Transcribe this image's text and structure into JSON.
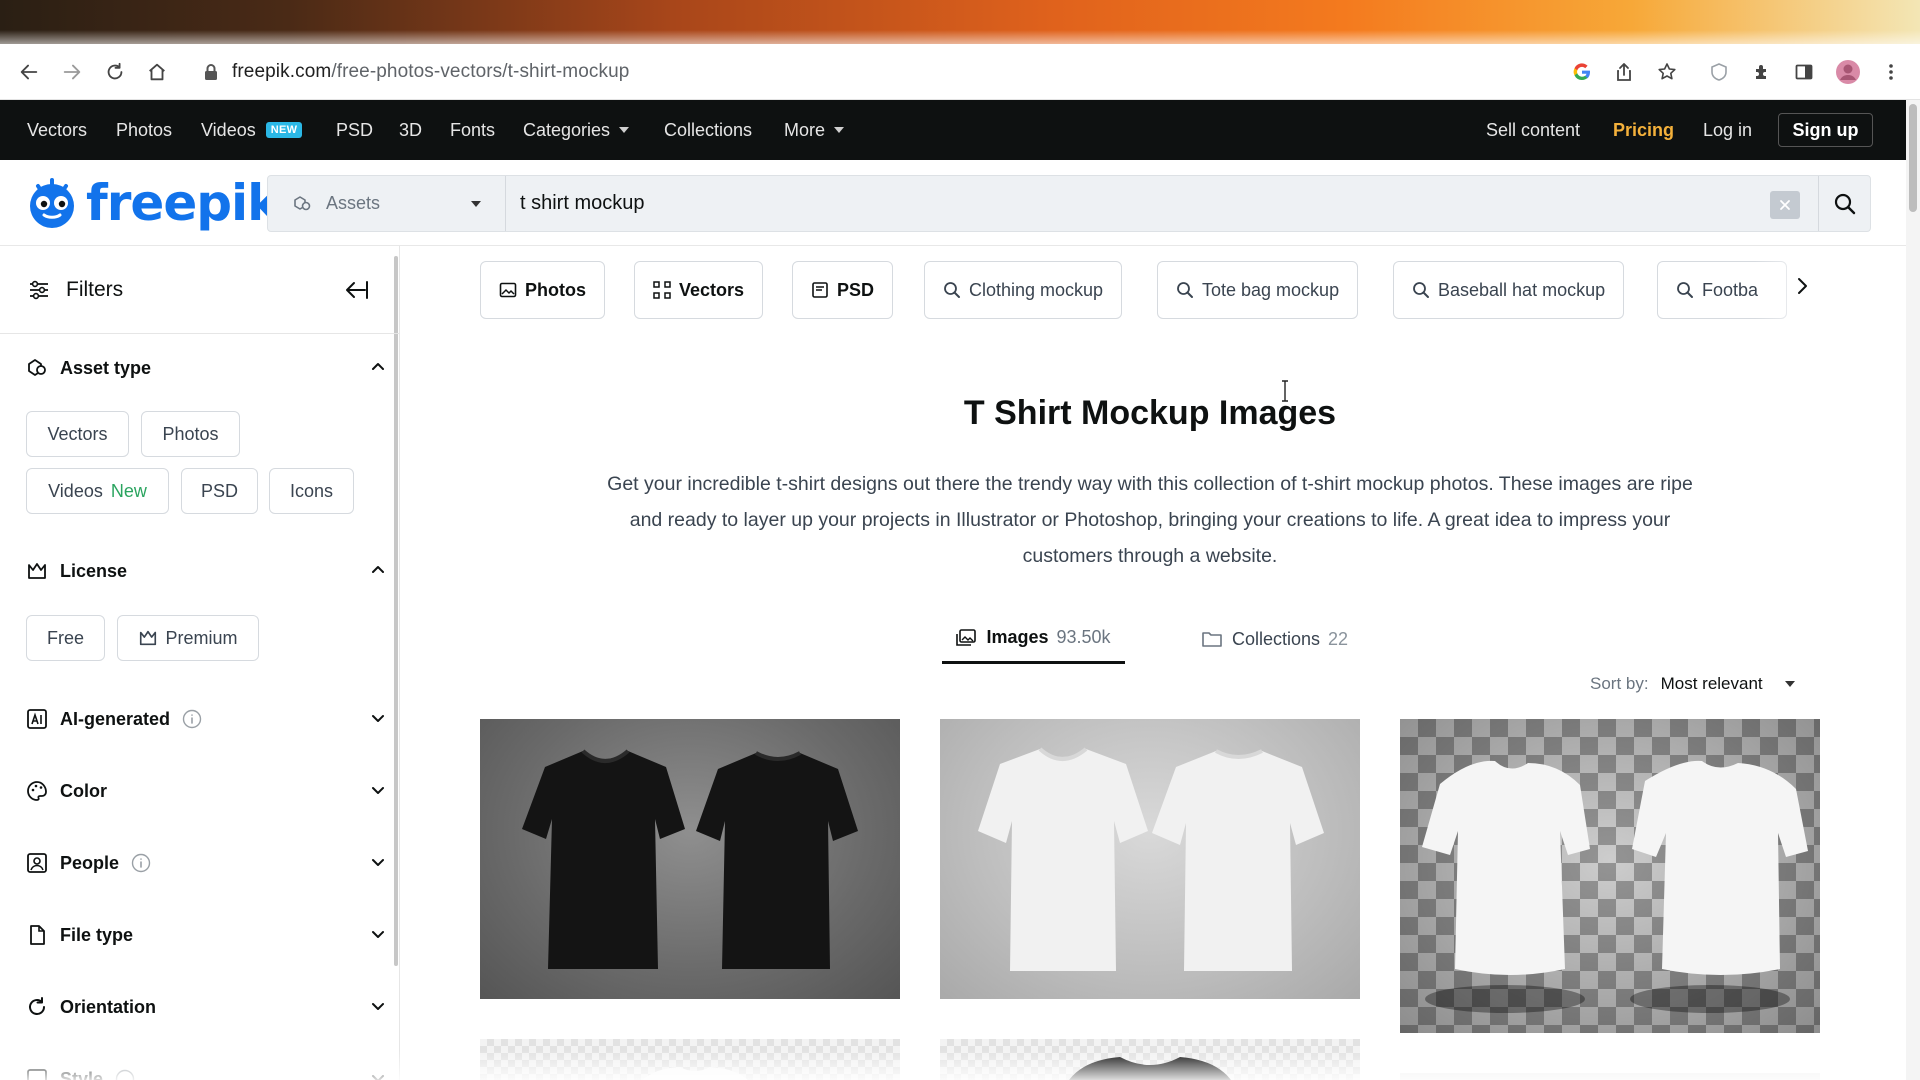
{
  "browser": {
    "url_host": "freepik.com",
    "url_path": "/free-photos-vectors/t-shirt-mockup"
  },
  "site_nav": {
    "items": [
      "Vectors",
      "Photos",
      "Videos",
      "PSD",
      "3D",
      "Fonts",
      "Categories",
      "Collections",
      "More"
    ],
    "new_badge": "NEW",
    "right": {
      "sell": "Sell content",
      "pricing": "Pricing",
      "login": "Log in",
      "signup": "Sign up"
    }
  },
  "logo": {
    "text": "freepik"
  },
  "search": {
    "asset_type": "Assets",
    "query": "t shirt mockup"
  },
  "sidebar": {
    "title": "Filters",
    "asset_type": {
      "title": "Asset type",
      "chips": [
        "Vectors",
        "Photos",
        "Videos",
        "PSD",
        "Icons"
      ],
      "new_label": "New"
    },
    "license": {
      "title": "License",
      "chips": [
        "Free",
        "Premium"
      ]
    },
    "sections": [
      "AI-generated",
      "Color",
      "People",
      "File type",
      "Orientation",
      "Style"
    ]
  },
  "main": {
    "quick_chips": [
      "Photos",
      "Vectors",
      "PSD",
      "Clothing mockup",
      "Tote bag mockup",
      "Baseball hat mockup",
      "Footba"
    ],
    "title": "T Shirt Mockup Images",
    "description": "Get your incredible t-shirt designs out there the trendy way with this collection of t-shirt mockup photos. These images are ripe and ready to layer up your projects in Illustrator or Photoshop, bringing your creations to life. A great idea to impress your customers through a website.",
    "tabs": [
      {
        "label": "Images",
        "count": "93.50k"
      },
      {
        "label": "Collections",
        "count": "22"
      }
    ],
    "sort": {
      "label": "Sort by:",
      "value": "Most relevant"
    }
  },
  "colors": {
    "nav_bg": "#0e1111",
    "brand_blue": "#1273eb",
    "pricing": "#f4b13b",
    "new_badge": "#2bb8e6",
    "new_text": "#2aa45f"
  }
}
